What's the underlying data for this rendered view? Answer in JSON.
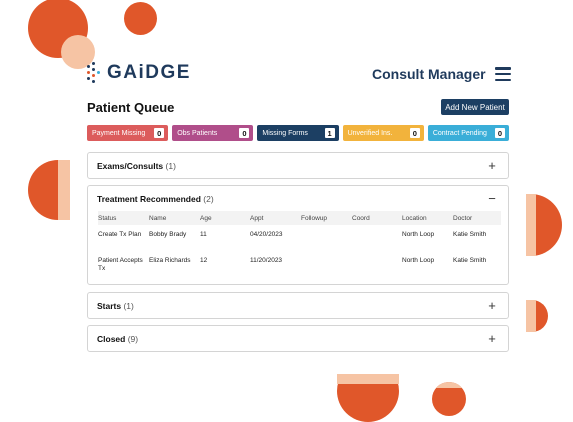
{
  "brand": {
    "name": "GAiDGE"
  },
  "header": {
    "app_title": "Consult Manager"
  },
  "page": {
    "title": "Patient Queue",
    "add_button": "Add New Patient"
  },
  "badges": [
    {
      "label": "Payment Missing",
      "count": "0",
      "color": "#dc5c5c"
    },
    {
      "label": "Obs Patients",
      "count": "0",
      "color": "#b04e8a"
    },
    {
      "label": "Missing Forms",
      "count": "1",
      "color": "#1c3f63"
    },
    {
      "label": "Unverified Ins.",
      "count": "0",
      "color": "#f2b33c"
    },
    {
      "label": "Contract Pending",
      "count": "0",
      "color": "#3aaed8"
    }
  ],
  "sections": {
    "exams": {
      "title": "Exams/Consults",
      "count": "(1)",
      "toggle": "+"
    },
    "treatment": {
      "title": "Treatment Recommended",
      "count": "(2)",
      "toggle": "−",
      "columns": [
        "Status",
        "Name",
        "Age",
        "Appt",
        "Followup",
        "Coord",
        "Location",
        "Doctor"
      ],
      "rows": [
        {
          "status": "Create Tx Plan",
          "name": "Bobby Brady",
          "age": "11",
          "appt": "04/20/2023",
          "followup": "",
          "coord": "",
          "location": "North Loop",
          "doctor": "Katie Smith"
        },
        {
          "status": "Patient Accepts Tx",
          "name": "Eliza Richards",
          "age": "12",
          "appt": "11/20/2023",
          "followup": "",
          "coord": "",
          "location": "North Loop",
          "doctor": "Katie Smith"
        }
      ]
    },
    "starts": {
      "title": "Starts",
      "count": "(1)",
      "toggle": "+"
    },
    "closed": {
      "title": "Closed",
      "count": "(9)",
      "toggle": "+"
    }
  },
  "colors": {
    "accent_orange": "#e0572a",
    "peach": "#f6c4a4",
    "navy": "#1f3a5c"
  }
}
